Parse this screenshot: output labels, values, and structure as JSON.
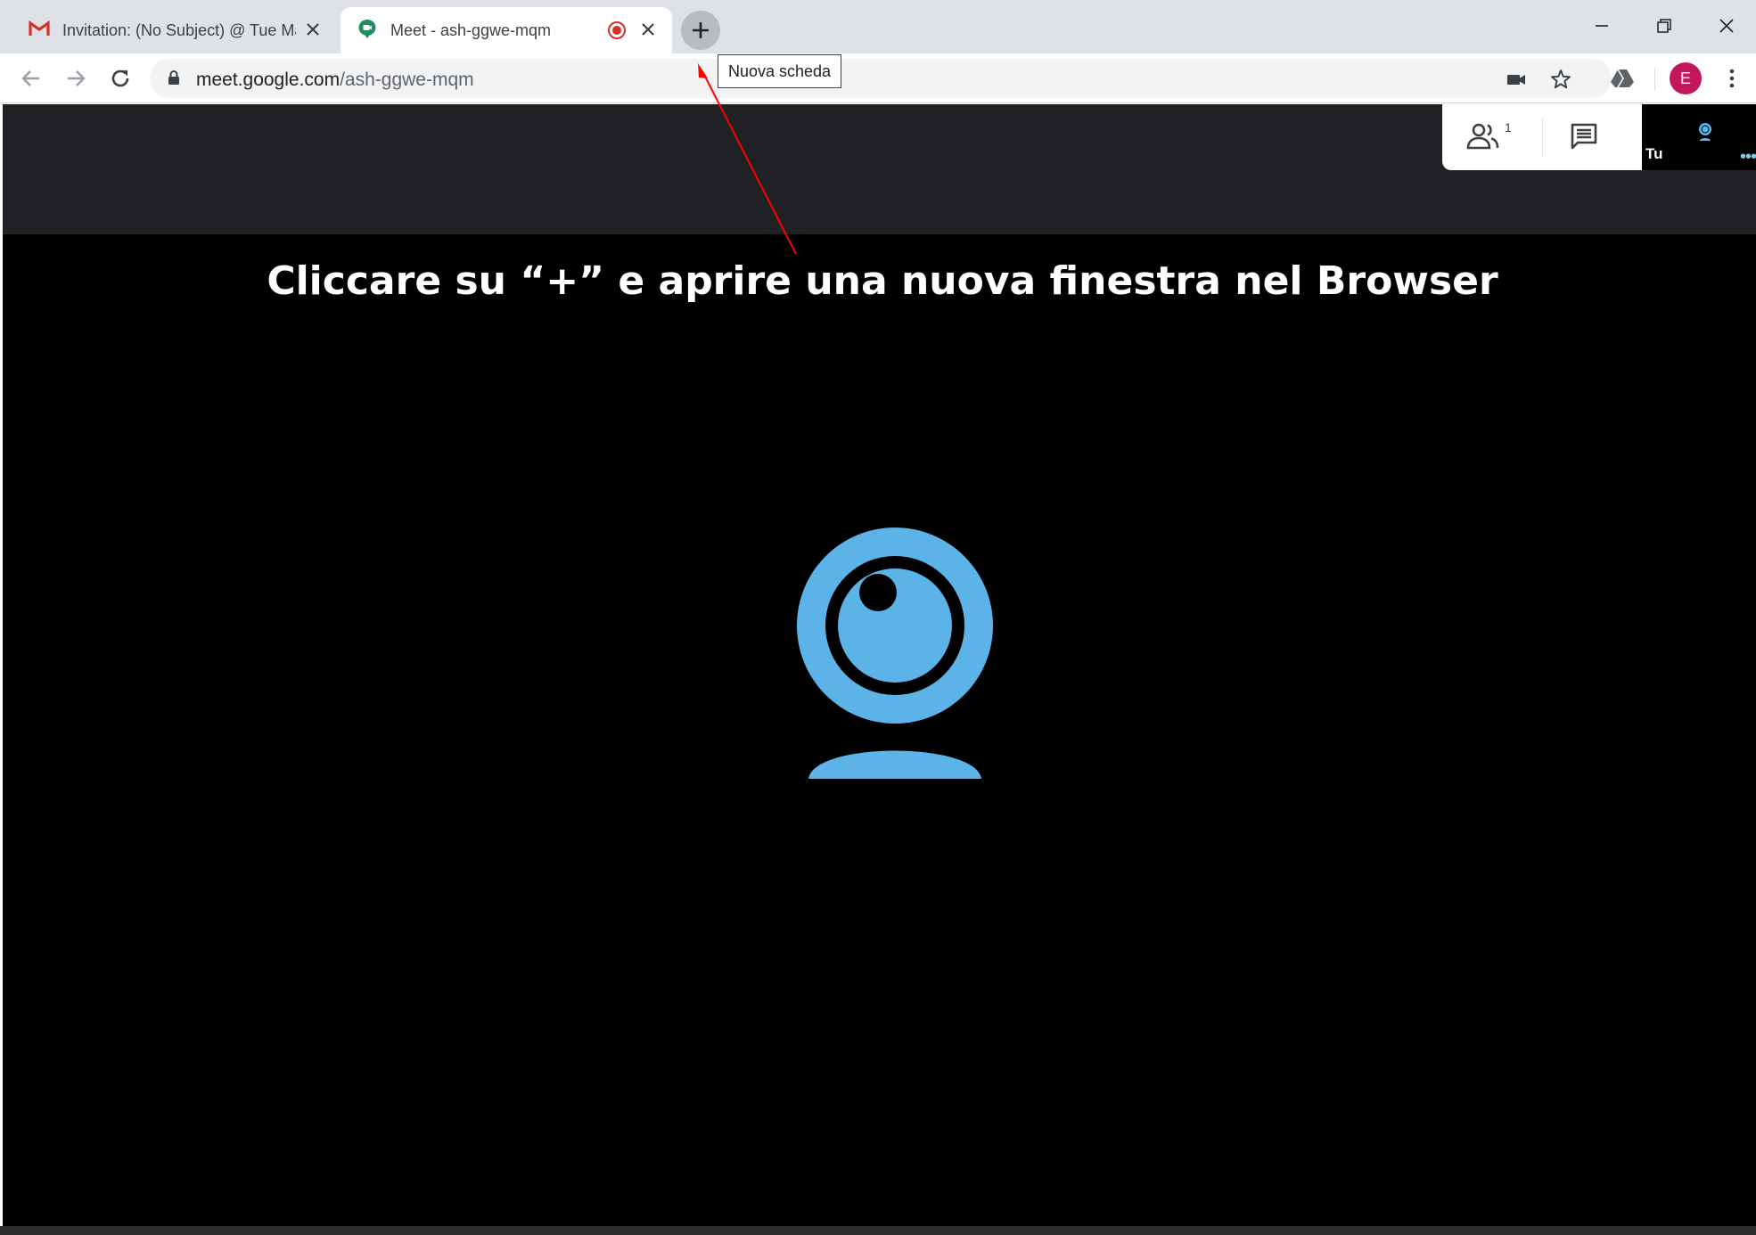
{
  "browser": {
    "tabs": [
      {
        "title": "Invitation: (No Subject) @ Tue Ma",
        "favicon": "gmail-icon",
        "active": false
      },
      {
        "title": "Meet - ash-ggwe-mqm",
        "favicon": "meet-icon",
        "active": true,
        "recording": true
      }
    ],
    "new_tab_tooltip": "Nuova scheda",
    "url": {
      "domain": "meet.google.com",
      "path": "/ash-ggwe-mqm"
    },
    "profile_initial": "E"
  },
  "meet": {
    "participants_count": "1",
    "self_label": "Tu"
  },
  "annotation": {
    "caption": "Cliccare su “+” e aprire una nuova finestra nel Browser",
    "arrow_color": "#ff0000"
  },
  "colors": {
    "webcam_blue": "#5cb3e8",
    "profile_pink": "#c2185b",
    "recording_red": "#d93025"
  }
}
